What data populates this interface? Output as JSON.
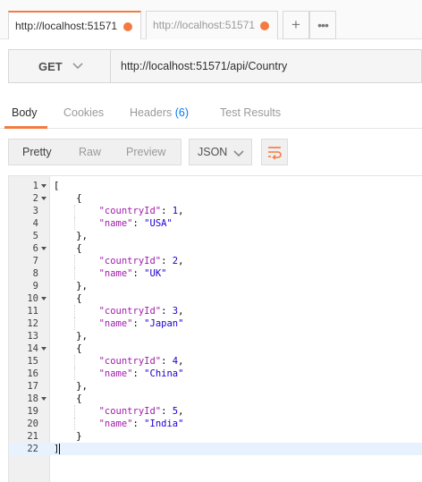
{
  "tabs": [
    {
      "label": "http://localhost:51571",
      "active": true,
      "unsaved": true
    },
    {
      "label": "http://localhost:51571",
      "active": false,
      "unsaved": true
    }
  ],
  "tab_actions": {
    "add_label": "+",
    "more_label": "•••"
  },
  "request": {
    "method": "GET",
    "url": "http://localhost:51571/api/Country"
  },
  "response_tabs": {
    "body": "Body",
    "cookies": "Cookies",
    "headers": "Headers",
    "headers_count": "(6)",
    "tests": "Test Results"
  },
  "view_modes": {
    "pretty": "Pretty",
    "raw": "Raw",
    "preview": "Preview"
  },
  "format": {
    "selected": "JSON"
  },
  "code": {
    "active_line": 22,
    "lines": [
      {
        "n": "1",
        "fold": true,
        "parts": [
          [
            "punc",
            "["
          ]
        ]
      },
      {
        "n": "2",
        "fold": true,
        "parts": [
          [
            "punc",
            "    {"
          ]
        ]
      },
      {
        "n": "3",
        "fold": false,
        "parts": [
          [
            "punc",
            "        "
          ],
          [
            "key",
            "\"countryId\""
          ],
          [
            "punc",
            ": "
          ],
          [
            "num",
            "1"
          ],
          [
            "punc",
            ","
          ]
        ]
      },
      {
        "n": "4",
        "fold": false,
        "parts": [
          [
            "punc",
            "        "
          ],
          [
            "key",
            "\"name\""
          ],
          [
            "punc",
            ": "
          ],
          [
            "str",
            "\"USA\""
          ]
        ]
      },
      {
        "n": "5",
        "fold": false,
        "parts": [
          [
            "punc",
            "    },"
          ]
        ]
      },
      {
        "n": "6",
        "fold": true,
        "parts": [
          [
            "punc",
            "    {"
          ]
        ]
      },
      {
        "n": "7",
        "fold": false,
        "parts": [
          [
            "punc",
            "        "
          ],
          [
            "key",
            "\"countryId\""
          ],
          [
            "punc",
            ": "
          ],
          [
            "num",
            "2"
          ],
          [
            "punc",
            ","
          ]
        ]
      },
      {
        "n": "8",
        "fold": false,
        "parts": [
          [
            "punc",
            "        "
          ],
          [
            "key",
            "\"name\""
          ],
          [
            "punc",
            ": "
          ],
          [
            "str",
            "\"UK\""
          ]
        ]
      },
      {
        "n": "9",
        "fold": false,
        "parts": [
          [
            "punc",
            "    },"
          ]
        ]
      },
      {
        "n": "10",
        "fold": true,
        "parts": [
          [
            "punc",
            "    {"
          ]
        ]
      },
      {
        "n": "11",
        "fold": false,
        "parts": [
          [
            "punc",
            "        "
          ],
          [
            "key",
            "\"countryId\""
          ],
          [
            "punc",
            ": "
          ],
          [
            "num",
            "3"
          ],
          [
            "punc",
            ","
          ]
        ]
      },
      {
        "n": "12",
        "fold": false,
        "parts": [
          [
            "punc",
            "        "
          ],
          [
            "key",
            "\"name\""
          ],
          [
            "punc",
            ": "
          ],
          [
            "str",
            "\"Japan\""
          ]
        ]
      },
      {
        "n": "13",
        "fold": false,
        "parts": [
          [
            "punc",
            "    },"
          ]
        ]
      },
      {
        "n": "14",
        "fold": true,
        "parts": [
          [
            "punc",
            "    {"
          ]
        ]
      },
      {
        "n": "15",
        "fold": false,
        "parts": [
          [
            "punc",
            "        "
          ],
          [
            "key",
            "\"countryId\""
          ],
          [
            "punc",
            ": "
          ],
          [
            "num",
            "4"
          ],
          [
            "punc",
            ","
          ]
        ]
      },
      {
        "n": "16",
        "fold": false,
        "parts": [
          [
            "punc",
            "        "
          ],
          [
            "key",
            "\"name\""
          ],
          [
            "punc",
            ": "
          ],
          [
            "str",
            "\"China\""
          ]
        ]
      },
      {
        "n": "17",
        "fold": false,
        "parts": [
          [
            "punc",
            "    },"
          ]
        ]
      },
      {
        "n": "18",
        "fold": true,
        "parts": [
          [
            "punc",
            "    {"
          ]
        ]
      },
      {
        "n": "19",
        "fold": false,
        "parts": [
          [
            "punc",
            "        "
          ],
          [
            "key",
            "\"countryId\""
          ],
          [
            "punc",
            ": "
          ],
          [
            "num",
            "5"
          ],
          [
            "punc",
            ","
          ]
        ]
      },
      {
        "n": "20",
        "fold": false,
        "parts": [
          [
            "punc",
            "        "
          ],
          [
            "key",
            "\"name\""
          ],
          [
            "punc",
            ": "
          ],
          [
            "str",
            "\"India\""
          ]
        ]
      },
      {
        "n": "21",
        "fold": false,
        "parts": [
          [
            "punc",
            "    }"
          ]
        ]
      },
      {
        "n": "22",
        "fold": false,
        "parts": [
          [
            "punc",
            "]"
          ]
        ]
      }
    ]
  },
  "colors": {
    "accent": "#f37b41",
    "link": "#097bed",
    "json_key": "#a11dab",
    "json_value": "#1c00cf"
  }
}
